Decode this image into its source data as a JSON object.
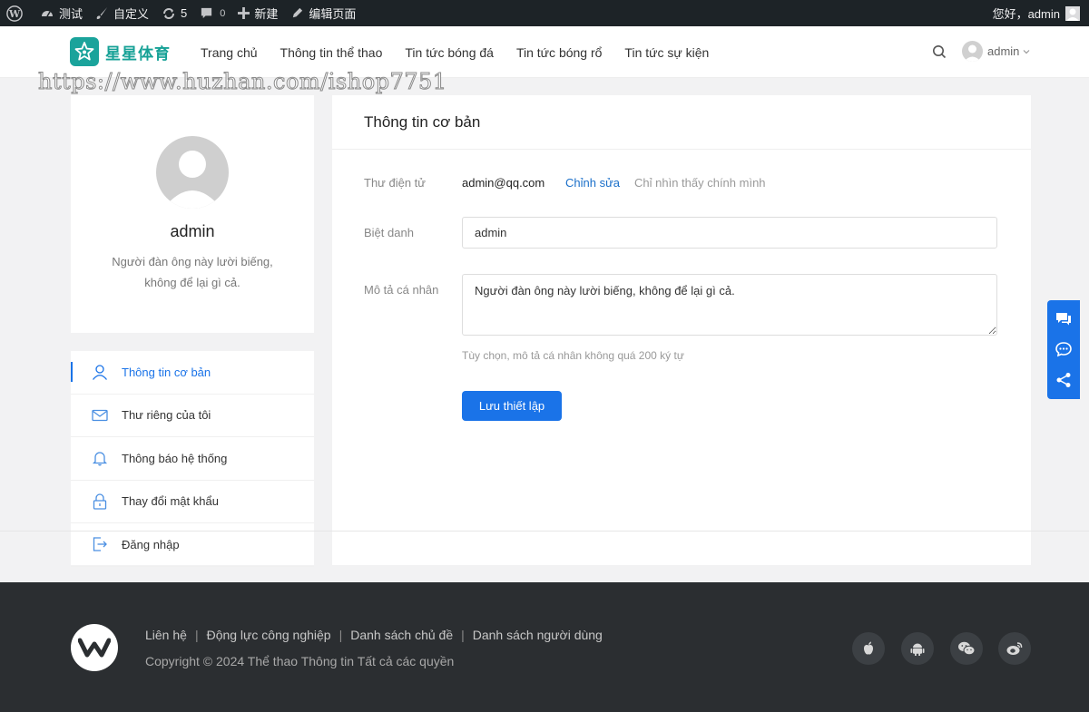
{
  "adminbar": {
    "site_name": "测试",
    "customize": "自定义",
    "updates_count": "5",
    "comments_count": "0",
    "new_label": "新建",
    "edit_page": "编辑页面",
    "greeting": "您好，admin"
  },
  "header": {
    "logo_text": "星星体育",
    "nav": [
      "Trang chủ",
      "Thông tin thể thao",
      "Tin tức bóng đá",
      "Tin tức bóng rổ",
      "Tin tức sự kiện"
    ],
    "user_name": "admin",
    "watermark": "https://www.huzhan.com/ishop7751"
  },
  "profile": {
    "name": "admin",
    "description": "Người đàn ông này lười biếng, không để lại gì cả."
  },
  "side_menu": {
    "items": [
      {
        "label": "Thông tin cơ bản",
        "icon": "user-icon"
      },
      {
        "label": "Thư riêng của tôi",
        "icon": "mail-icon"
      },
      {
        "label": "Thông báo hệ thống",
        "icon": "bell-icon"
      },
      {
        "label": "Thay đổi mật khẩu",
        "icon": "lock-icon"
      },
      {
        "label": "Đăng nhập",
        "icon": "logout-icon"
      }
    ]
  },
  "main": {
    "title": "Thông tin cơ bản",
    "email_label": "Thư điện tử",
    "email_value": "admin@qq.com",
    "edit_link": "Chỉnh sửa",
    "only_me": "Chỉ nhìn thấy chính mình",
    "nickname_label": "Biệt danh",
    "nickname_value": "admin",
    "bio_label": "Mô tả cá nhân",
    "bio_value": "Người đàn ông này lười biếng, không để lại gì cả.",
    "bio_hint": "Tùy chọn, mô tả cá nhân không quá 200 ký tự",
    "save_button": "Lưu thiết lập"
  },
  "footer": {
    "links": [
      "Liên hệ",
      "Động lực công nghiệp",
      "Danh sách chủ đề",
      "Danh sách người dùng"
    ],
    "separator": "|",
    "copyright": "Copyright © 2024 Thể thao Thông tin Tất cả các quyền"
  },
  "colors": {
    "accent": "#1a73e8",
    "brand": "#16a196",
    "footer_bg": "#2b2e31",
    "adminbar_bg": "#1d2327"
  }
}
